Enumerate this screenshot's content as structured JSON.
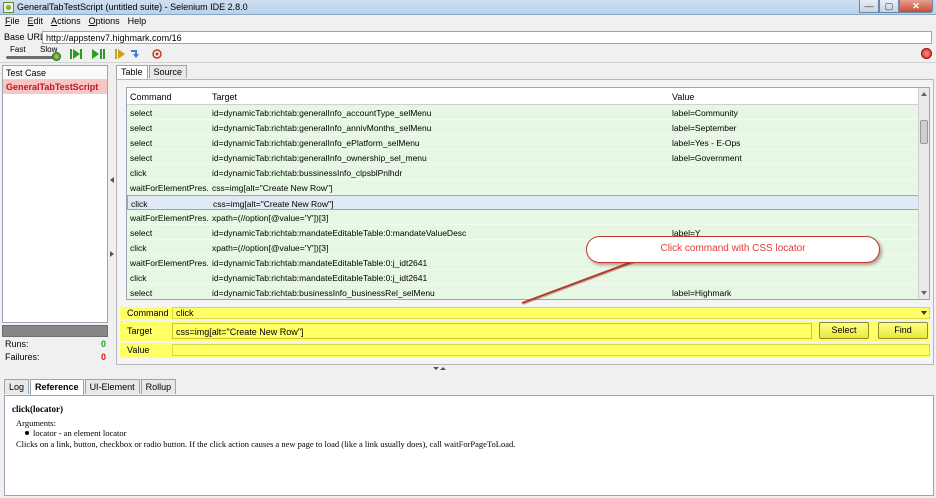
{
  "window": {
    "title": "GeneralTabTestScript (untitled suite) - Selenium IDE 2.8.0",
    "blurred_text": "..............................",
    "minimize": "—",
    "maximize": "▢",
    "close": "✕"
  },
  "menu": {
    "items": [
      {
        "u": "F",
        "rest": "ile"
      },
      {
        "u": "E",
        "rest": "dit"
      },
      {
        "u": "A",
        "rest": "ctions"
      },
      {
        "u": "O",
        "rest": "ptions"
      },
      {
        "u": "",
        "rest": "Help"
      }
    ]
  },
  "base_url": {
    "label": "Base URL",
    "value": "http://appstenv7.highmark.com/16"
  },
  "toolbar": {
    "speed_fast": "Fast",
    "speed_slow": "Slow",
    "speed": 1.0
  },
  "suite_panel": {
    "header": "Test Case",
    "selected_test": "GeneralTabTestScript"
  },
  "stats": {
    "runs_label": "Runs:",
    "runs_value": "0",
    "failures_label": "Failures:",
    "failures_value": "0"
  },
  "editor_tabs": [
    "Table",
    "Source"
  ],
  "table": {
    "headers": {
      "command": "Command",
      "target": "Target",
      "value": "Value"
    },
    "selected_index": 6,
    "rows": [
      {
        "command": "select",
        "target": "id=dynamicTab:richtab:generalInfo_accountType_selMenu",
        "value": "label=Community"
      },
      {
        "command": "select",
        "target": "id=dynamicTab:richtab:generalInfo_annivMonths_selMenu",
        "value": "label=September"
      },
      {
        "command": "select",
        "target": "id=dynamicTab:richtab:generalInfo_ePlatform_selMenu",
        "value": "label=Yes - E-Ops"
      },
      {
        "command": "select",
        "target": "id=dynamicTab:richtab:generalInfo_ownership_sel_menu",
        "value": "label=Government"
      },
      {
        "command": "click",
        "target": "id=dynamicTab:richtab:bussinessInfo_clpsblPnlhdr",
        "value": ""
      },
      {
        "command": "waitForElementPres...",
        "target": "css=img[alt=\"Create New Row\"]",
        "value": ""
      },
      {
        "command": "click",
        "target": "css=img[alt=\"Create New Row\"]",
        "value": ""
      },
      {
        "command": "waitForElementPres...",
        "target": "xpath=(//option[@value='Y'])[3]",
        "value": ""
      },
      {
        "command": "select",
        "target": "id=dynamicTab:richtab:mandateEditableTable:0:mandateValueDesc",
        "value": "label=Y"
      },
      {
        "command": "click",
        "target": "xpath=(//option[@value='Y'])[3]",
        "value": ""
      },
      {
        "command": "waitForElementPres...",
        "target": "id=dynamicTab:richtab:mandateEditableTable:0:j_idt2641",
        "value": ""
      },
      {
        "command": "click",
        "target": "id=dynamicTab:richtab:mandateEditableTable:0:j_idt2641",
        "value": ""
      },
      {
        "command": "select",
        "target": "id=dynamicTab:richtab:businessInfo_businessRel_selMenu",
        "value": "label=Highmark"
      }
    ]
  },
  "editor": {
    "command_label": "Command",
    "command_value": "click",
    "target_label": "Target",
    "target_value": "css=img[alt=\"Create New Row\"]",
    "value_label": "Value",
    "value_value": "",
    "select_button": "Select",
    "find_button": "Find"
  },
  "callout": {
    "text": "Click command with CSS locator"
  },
  "bottom_tabs": [
    "Log",
    "Reference",
    "UI-Element",
    "Rollup"
  ],
  "reference": {
    "signature": "click(locator)",
    "arguments_label": "Arguments:",
    "argument": "locator - an element locator",
    "description": "Clicks on a link, button, checkbox or radio button. If the click action causes a new page to load (like a link usually does), call waitForPageToLoad."
  },
  "colors": {
    "row_green": "#e6f8e3",
    "selected_row": "#dfeaf5",
    "editor_yellow": "#ffff66",
    "callout_red": "#e53935",
    "suite_highlight": "#f7c6c6"
  }
}
